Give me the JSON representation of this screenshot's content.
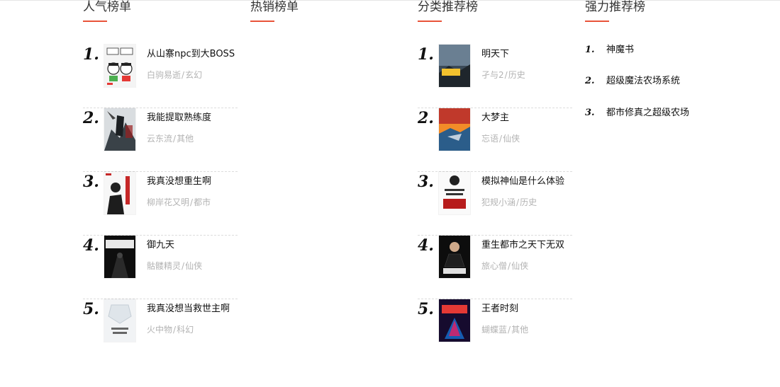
{
  "columns": [
    {
      "title": "人气榜单",
      "items": [
        {
          "rank": "1.",
          "title": "从山寨npc到大BOSS",
          "author": "白驹易逝",
          "genre": "玄幻",
          "cover_icon": "cartoon-cover"
        },
        {
          "rank": "2.",
          "title": "我能提取熟练度",
          "author": "云东流",
          "genre": "其他",
          "cover_icon": "warrior-cover"
        },
        {
          "rank": "3.",
          "title": "我真没想重生啊",
          "author": "柳岸花又明",
          "genre": "都市",
          "cover_icon": "student-cover"
        },
        {
          "rank": "4.",
          "title": "御九天",
          "author": "骷髅精灵",
          "genre": "仙侠",
          "cover_icon": "dark-title-cover"
        },
        {
          "rank": "5.",
          "title": "我真没想当救世主啊",
          "author": "火中物",
          "genre": "科幻",
          "cover_icon": "light-cover"
        }
      ]
    },
    {
      "title": "热销榜单",
      "items": []
    },
    {
      "title": "分类推荐榜",
      "items": [
        {
          "rank": "1.",
          "title": "明天下",
          "author": "孑与2",
          "genre": "历史",
          "cover_icon": "sky-cover"
        },
        {
          "rank": "2.",
          "title": "大梦主",
          "author": "忘语",
          "genre": "仙侠",
          "cover_icon": "fire-cover"
        },
        {
          "rank": "3.",
          "title": "模拟神仙是什么体验",
          "author": "犯规小涵",
          "genre": "历史",
          "cover_icon": "sketch-cover"
        },
        {
          "rank": "4.",
          "title": "重生都市之天下无双",
          "author": "旅心僧",
          "genre": "仙侠",
          "cover_icon": "suit-cover"
        },
        {
          "rank": "5.",
          "title": "王者时刻",
          "author": "蝴蝶蓝",
          "genre": "其他",
          "cover_icon": "neon-cover"
        }
      ]
    }
  ],
  "strong": {
    "title": "强力推荐榜",
    "items": [
      {
        "rank": "1.",
        "title": "神魔书"
      },
      {
        "rank": "2.",
        "title": "超级魔法农场系统"
      },
      {
        "rank": "3.",
        "title": "都市修真之超级农场"
      }
    ]
  },
  "colors": {
    "accent": "#e8533a",
    "title": "#333333",
    "meta": "#b3b3b3"
  }
}
